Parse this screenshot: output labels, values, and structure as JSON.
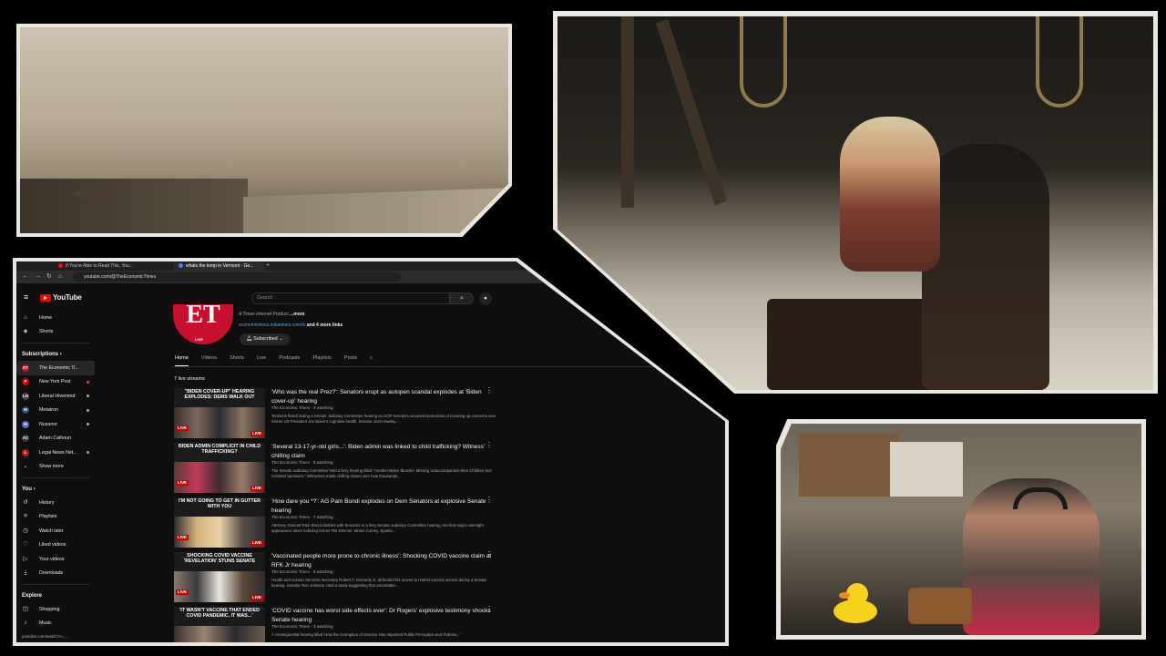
{
  "browser": {
    "tabs": [
      {
        "label": "If You're Able to Read This, You..."
      },
      {
        "label": "whats the temp in Vermont - Go..."
      }
    ],
    "url": "youtube.com/@TheEconomicTimes"
  },
  "youtube": {
    "logo_text": "YouTube",
    "search_placeholder": "Search",
    "sidebar": {
      "main": [
        {
          "label": "Home",
          "icon": "home-icon",
          "glyph": "⌂"
        },
        {
          "label": "Shorts",
          "icon": "shorts-icon",
          "glyph": "◈"
        }
      ],
      "subscriptions_title": "Subscriptions",
      "subscriptions": [
        {
          "label": "The Economic Ti...",
          "avatar_color": "#c8102e",
          "initials": "ET"
        },
        {
          "label": "New York Post",
          "avatar_color": "#d40000",
          "initials": "P"
        },
        {
          "label": "Liberal Hivemind",
          "avatar_color": "#444444",
          "initials": "LH"
        },
        {
          "label": "Metatron",
          "avatar_color": "#2a4d7a",
          "initials": "M"
        },
        {
          "label": "Nuzanor",
          "avatar_color": "#5a6ccf",
          "initials": "N"
        },
        {
          "label": "Adam Calhoun",
          "avatar_color": "#3b3b3b",
          "initials": "AC"
        },
        {
          "label": "Legal News Net...",
          "avatar_color": "#b71c1c",
          "initials": "L"
        }
      ],
      "show_more": "Show more",
      "you_title": "You",
      "you": [
        {
          "label": "History",
          "icon": "history-icon",
          "glyph": "↺"
        },
        {
          "label": "Playlists",
          "icon": "playlists-icon",
          "glyph": "≡"
        },
        {
          "label": "Watch later",
          "icon": "clock-icon",
          "glyph": "◷"
        },
        {
          "label": "Liked videos",
          "icon": "thumbs-up-icon",
          "glyph": "♡"
        },
        {
          "label": "Your videos",
          "icon": "your-videos-icon",
          "glyph": "▷"
        },
        {
          "label": "Downloads",
          "icon": "download-icon",
          "glyph": "⤓"
        }
      ],
      "explore_title": "Explore",
      "explore": [
        {
          "label": "Shopping",
          "icon": "shopping-icon",
          "glyph": "◫"
        },
        {
          "label": "Music",
          "icon": "music-icon",
          "glyph": "♪"
        }
      ]
    },
    "channel": {
      "logo_text": "ET",
      "logo_live": "LIVE",
      "description": "A Times Internet Product",
      "more": "...more",
      "link": "economictimes.indiatimes.com/tv",
      "more_links": "and 4 more links",
      "subscribed": "Subscribed"
    },
    "channel_tabs": [
      "Home",
      "Videos",
      "Shorts",
      "Live",
      "Podcasts",
      "Playlists",
      "Posts"
    ],
    "live_count": "7 live streams",
    "videos": [
      {
        "thumb_caption": "\"BIDEN COVER-UP\" HEARING EXPLODES: DEMS WALK OUT",
        "title": "'Who was the real Prez?': Senators erupt as autopen scandal explodes at 'Biden cover-up' hearing",
        "channel": "The Economic Times",
        "watching": "9 watching",
        "description": "Tensions flared during a Senate Judiciary Committee hearing as GOP Senators accused Democrats of covering up concerns over former US President Joe Biden's cognitive health. Senator Josh Hawley..."
      },
      {
        "thumb_caption": "BIDEN ADMIN COMPLICIT IN CHILD TRAFFICKING?",
        "title": "'Several 13-17-yr-old girls...': Biden admin was linked to child trafficking? Witness' chilling claim",
        "channel": "The Economic Times",
        "watching": "5 watching",
        "description": "The Senate Judiciary Committee held a fiery hearing titled \"Another Biden Blunder: Missing Unaccompanied Alien Children and Criminal Sponsors.\" Witnesses made chilling claims over how thousands..."
      },
      {
        "thumb_caption": "I'M NOT GOING TO GET IN GUTTER WITH YOU",
        "title": "'How dare you *?': AG Pam Bondi explodes on Dem Senators at explosive Senate hearing",
        "channel": "The Economic Times",
        "watching": "7 watching",
        "description": "Attorney General Pam Bondi clashes with Senators in a fiery Senate Judiciary Committee hearing, her first major oversight appearance since indicting former FBI Director James Comey. Sparks..."
      },
      {
        "thumb_caption": "SHOCKING COVID VACCINE 'REVELATION' STUNS SENATE",
        "title": "'Vaccinated people more prone to chronic illness': Shocking COVID vaccine claim at RFK Jr hearing",
        "channel": "The Economic Times",
        "watching": "8 watching",
        "description": "Health and Human Services Secretary Robert F. Kennedy Jr. defended his moves to restrict vaccine access during a Senate hearing. Senator Ron Johnson cited a study suggesting that vaccinated..."
      },
      {
        "thumb_caption": "'IT WASN'T VACCINE THAT ENDED COVID PANDEMIC, IT WAS...'",
        "title": "'COVID vaccine has worst side effects ever': Dr Rogers' explosive testimony shocks Senate hearing",
        "channel": "The Economic Times",
        "watching": "3 watching",
        "description": "A consequential hearing titled 'How the Corruption of Science Has Impacted Public Perception and Policies...'"
      }
    ],
    "live_label": "LIVE",
    "status_url": "youtube.com/watch?v=..."
  },
  "colors": {
    "youtube_red": "#ff0000",
    "background": "#0f0f0f",
    "link_blue": "#3ea6ff",
    "frame": "#e9e6df"
  }
}
